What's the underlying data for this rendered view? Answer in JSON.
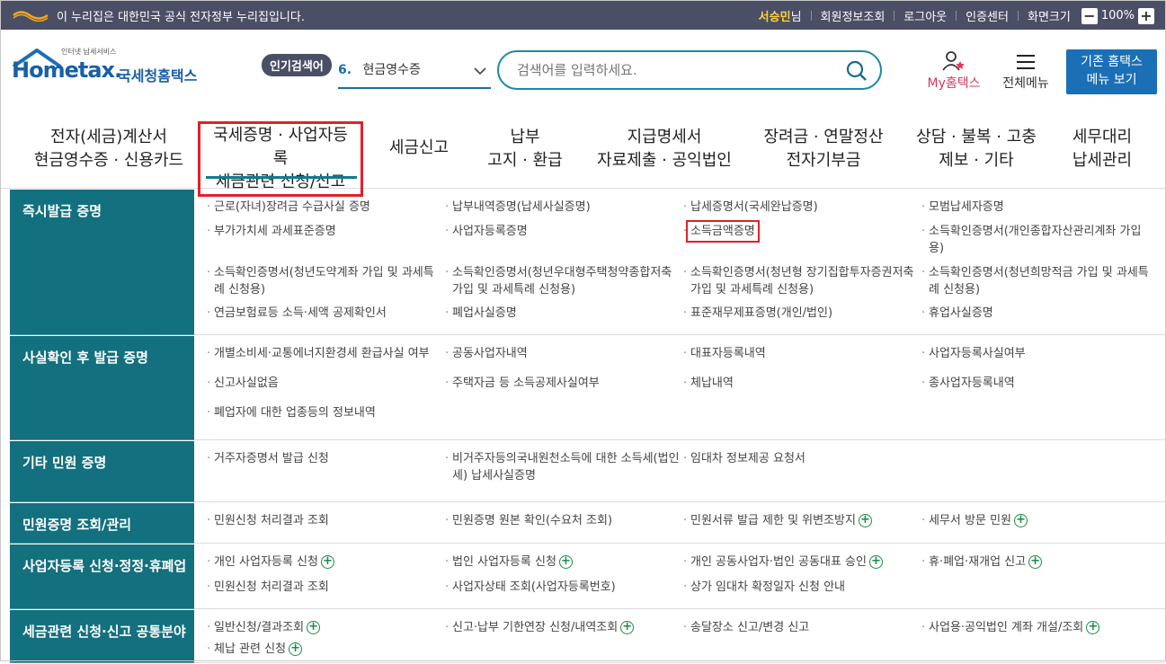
{
  "govbar": {
    "message": "이 누리집은 대한민국 공식 전자정부 누리집입니다.",
    "user_name": "서승민",
    "user_suffix": "님",
    "links": [
      "회원정보조회",
      "로그아웃",
      "인증센터",
      "화면크기"
    ],
    "zoom": "100%",
    "zoom_minus": "−",
    "zoom_plus": "+"
  },
  "brand": {
    "tagline_left": "인터넷",
    "tagline_right": "납세서비스",
    "name": "Hometax.",
    "subtitle": "국세청홈택스"
  },
  "popular": {
    "badge": "인기검색어",
    "rank": "6.",
    "term": "현금영수증"
  },
  "search": {
    "placeholder": "검색어를 입력하세요."
  },
  "header_links": {
    "my_hometax": "My홈택스",
    "all_menu": "전체메뉴",
    "old_menu_line1": "기존 홈택스",
    "old_menu_line2": "메뉴 보기"
  },
  "gnb": [
    {
      "l1": "전자(세금)계산서",
      "l2": "현금영수증 · 신용카드"
    },
    {
      "l1": "국세증명 · 사업자등록",
      "l2": "세금관련 신청/신고"
    },
    {
      "l1": "세금신고",
      "l2": ""
    },
    {
      "l1": "납부",
      "l2": "고지 · 환급"
    },
    {
      "l1": "지급명세서",
      "l2": "자료제출 · 공익법인"
    },
    {
      "l1": "장려금 · 연말정산",
      "l2": "전자기부금"
    },
    {
      "l1": "상담 · 불복 · 고충",
      "l2": "제보 · 기타"
    },
    {
      "l1": "세무대리",
      "l2": "납세관리"
    }
  ],
  "sections": [
    {
      "title": "즉시발급 증명",
      "items": [
        "근로(자녀)장려금 수급사실 증명",
        "납부내역증명(납세사실증명)",
        "납세증명서(국세완납증명)",
        "모범납세자증명",
        "부가가치세 과세표준증명",
        "사업자등록증명",
        "소득금액증명",
        "소득확인증명서(개인종합자산관리계좌 가입용)",
        "소득확인증명서(청년도약계좌 가입 및 과세특례 신청용)",
        "소득확인증명서(청년우대형주택청약종합저축 가입 및 과세특례 신청용)",
        "소득확인증명서(청년형 장기집합투자증권저축 가입 및 과세특례 신청용)",
        "소득확인증명서(청년희망적금 가입 및 과세특례 신청용)",
        "연금보험료등 소득·세액 공제확인서",
        "폐업사실증명",
        "표준재무제표증명(개인/법인)",
        "휴업사실증명"
      ]
    },
    {
      "title": "사실확인 후 발급 증명",
      "items": [
        "개별소비세·교통에너지환경세 환급사실 여부",
        "공동사업자내역",
        "대표자등록내역",
        "사업자등록사실여부",
        "신고사실없음",
        "주택자금 등 소득공제사실여부",
        "체납내역",
        "종사업자등록내역",
        "폐업자에 대한 업종등의 정보내역"
      ]
    },
    {
      "title": "기타 민원 증명",
      "items": [
        "거주자증명서 발급 신청",
        "비거주자등의국내원천소득에 대한 소득세(법인세) 납세사실증명",
        "임대차 정보제공 요청서"
      ]
    },
    {
      "title": "민원증명 조회/관리",
      "items": [
        "민원신청 처리결과 조회",
        "민원증명 원본 확인(수요처 조회)",
        "민원서류 발급 제한 및 위변조방지",
        "세무서 방문 민원"
      ]
    },
    {
      "title": "사업자등록 신청·정정·휴폐업",
      "items": [
        "개인 사업자등록 신청",
        "법인 사업자등록 신청",
        "개인 공동사업자·법인 공동대표 승인",
        "휴·폐업·재개업 신고",
        "민원신청 처리결과 조회",
        "사업자상태 조회(사업자등록번호)",
        "상가 임대차 확정일자 신청 안내"
      ]
    },
    {
      "title": "세금관련 신청·신고 공통분야",
      "items": [
        "일반신청/결과조회",
        "신고·납부 기한연장 신청/내역조회",
        "송달장소 신고/변경 신고",
        "사업용·공익법인 계좌 개설/조회",
        "체납 관련 신청"
      ]
    }
  ]
}
